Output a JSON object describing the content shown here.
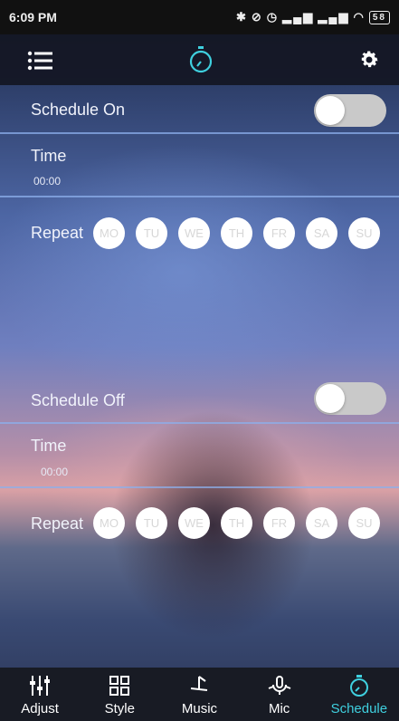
{
  "status": {
    "time": "6:09 PM",
    "battery": "58",
    "icons": [
      "bluetooth-icon",
      "alarm-off-icon",
      "alarm-icon",
      "signal-icon",
      "signal-icon",
      "wifi-icon",
      "battery-icon"
    ]
  },
  "header": {
    "icons": [
      "menu-icon",
      "timer-icon",
      "gear-icon"
    ]
  },
  "schedule_on": {
    "label": "Schedule On",
    "toggle": false,
    "time_label": "Time",
    "time_value": "00:00",
    "repeat_label": "Repeat",
    "days": [
      "MO",
      "TU",
      "WE",
      "TH",
      "FR",
      "SA",
      "SU"
    ]
  },
  "schedule_off": {
    "label": "Schedule Off",
    "toggle": false,
    "time_label": "Time",
    "time_value": "00:00",
    "repeat_label": "Repeat",
    "days": [
      "MO",
      "TU",
      "WE",
      "TH",
      "FR",
      "SA",
      "SU"
    ]
  },
  "tabs": [
    {
      "label": "Adjust",
      "icon": "sliders-icon"
    },
    {
      "label": "Style",
      "icon": "grid-icon"
    },
    {
      "label": "Music",
      "icon": "music-note-icon"
    },
    {
      "label": "Mic",
      "icon": "microphone-icon"
    },
    {
      "label": "Schedule",
      "icon": "timer-icon",
      "active": true
    }
  ],
  "colors": {
    "accent": "#3fd0df",
    "divider": "#8cafeb",
    "toggle_track": "#c9c9c9"
  }
}
